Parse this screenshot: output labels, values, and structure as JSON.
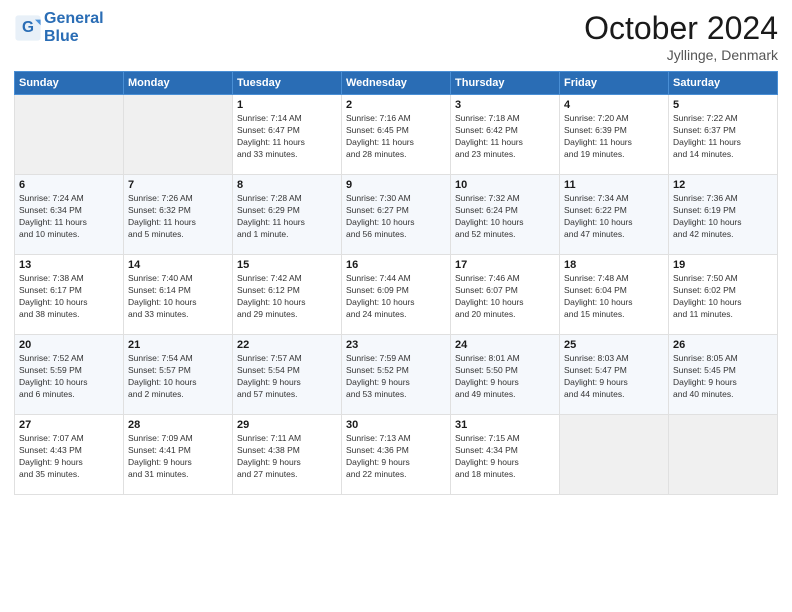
{
  "header": {
    "logo_line1": "General",
    "logo_line2": "Blue",
    "month_title": "October 2024",
    "location": "Jyllinge, Denmark"
  },
  "weekdays": [
    "Sunday",
    "Monday",
    "Tuesday",
    "Wednesday",
    "Thursday",
    "Friday",
    "Saturday"
  ],
  "weeks": [
    [
      {
        "day": "",
        "info": ""
      },
      {
        "day": "",
        "info": ""
      },
      {
        "day": "1",
        "info": "Sunrise: 7:14 AM\nSunset: 6:47 PM\nDaylight: 11 hours\nand 33 minutes."
      },
      {
        "day": "2",
        "info": "Sunrise: 7:16 AM\nSunset: 6:45 PM\nDaylight: 11 hours\nand 28 minutes."
      },
      {
        "day": "3",
        "info": "Sunrise: 7:18 AM\nSunset: 6:42 PM\nDaylight: 11 hours\nand 23 minutes."
      },
      {
        "day": "4",
        "info": "Sunrise: 7:20 AM\nSunset: 6:39 PM\nDaylight: 11 hours\nand 19 minutes."
      },
      {
        "day": "5",
        "info": "Sunrise: 7:22 AM\nSunset: 6:37 PM\nDaylight: 11 hours\nand 14 minutes."
      }
    ],
    [
      {
        "day": "6",
        "info": "Sunrise: 7:24 AM\nSunset: 6:34 PM\nDaylight: 11 hours\nand 10 minutes."
      },
      {
        "day": "7",
        "info": "Sunrise: 7:26 AM\nSunset: 6:32 PM\nDaylight: 11 hours\nand 5 minutes."
      },
      {
        "day": "8",
        "info": "Sunrise: 7:28 AM\nSunset: 6:29 PM\nDaylight: 11 hours\nand 1 minute."
      },
      {
        "day": "9",
        "info": "Sunrise: 7:30 AM\nSunset: 6:27 PM\nDaylight: 10 hours\nand 56 minutes."
      },
      {
        "day": "10",
        "info": "Sunrise: 7:32 AM\nSunset: 6:24 PM\nDaylight: 10 hours\nand 52 minutes."
      },
      {
        "day": "11",
        "info": "Sunrise: 7:34 AM\nSunset: 6:22 PM\nDaylight: 10 hours\nand 47 minutes."
      },
      {
        "day": "12",
        "info": "Sunrise: 7:36 AM\nSunset: 6:19 PM\nDaylight: 10 hours\nand 42 minutes."
      }
    ],
    [
      {
        "day": "13",
        "info": "Sunrise: 7:38 AM\nSunset: 6:17 PM\nDaylight: 10 hours\nand 38 minutes."
      },
      {
        "day": "14",
        "info": "Sunrise: 7:40 AM\nSunset: 6:14 PM\nDaylight: 10 hours\nand 33 minutes."
      },
      {
        "day": "15",
        "info": "Sunrise: 7:42 AM\nSunset: 6:12 PM\nDaylight: 10 hours\nand 29 minutes."
      },
      {
        "day": "16",
        "info": "Sunrise: 7:44 AM\nSunset: 6:09 PM\nDaylight: 10 hours\nand 24 minutes."
      },
      {
        "day": "17",
        "info": "Sunrise: 7:46 AM\nSunset: 6:07 PM\nDaylight: 10 hours\nand 20 minutes."
      },
      {
        "day": "18",
        "info": "Sunrise: 7:48 AM\nSunset: 6:04 PM\nDaylight: 10 hours\nand 15 minutes."
      },
      {
        "day": "19",
        "info": "Sunrise: 7:50 AM\nSunset: 6:02 PM\nDaylight: 10 hours\nand 11 minutes."
      }
    ],
    [
      {
        "day": "20",
        "info": "Sunrise: 7:52 AM\nSunset: 5:59 PM\nDaylight: 10 hours\nand 6 minutes."
      },
      {
        "day": "21",
        "info": "Sunrise: 7:54 AM\nSunset: 5:57 PM\nDaylight: 10 hours\nand 2 minutes."
      },
      {
        "day": "22",
        "info": "Sunrise: 7:57 AM\nSunset: 5:54 PM\nDaylight: 9 hours\nand 57 minutes."
      },
      {
        "day": "23",
        "info": "Sunrise: 7:59 AM\nSunset: 5:52 PM\nDaylight: 9 hours\nand 53 minutes."
      },
      {
        "day": "24",
        "info": "Sunrise: 8:01 AM\nSunset: 5:50 PM\nDaylight: 9 hours\nand 49 minutes."
      },
      {
        "day": "25",
        "info": "Sunrise: 8:03 AM\nSunset: 5:47 PM\nDaylight: 9 hours\nand 44 minutes."
      },
      {
        "day": "26",
        "info": "Sunrise: 8:05 AM\nSunset: 5:45 PM\nDaylight: 9 hours\nand 40 minutes."
      }
    ],
    [
      {
        "day": "27",
        "info": "Sunrise: 7:07 AM\nSunset: 4:43 PM\nDaylight: 9 hours\nand 35 minutes."
      },
      {
        "day": "28",
        "info": "Sunrise: 7:09 AM\nSunset: 4:41 PM\nDaylight: 9 hours\nand 31 minutes."
      },
      {
        "day": "29",
        "info": "Sunrise: 7:11 AM\nSunset: 4:38 PM\nDaylight: 9 hours\nand 27 minutes."
      },
      {
        "day": "30",
        "info": "Sunrise: 7:13 AM\nSunset: 4:36 PM\nDaylight: 9 hours\nand 22 minutes."
      },
      {
        "day": "31",
        "info": "Sunrise: 7:15 AM\nSunset: 4:34 PM\nDaylight: 9 hours\nand 18 minutes."
      },
      {
        "day": "",
        "info": ""
      },
      {
        "day": "",
        "info": ""
      }
    ]
  ]
}
